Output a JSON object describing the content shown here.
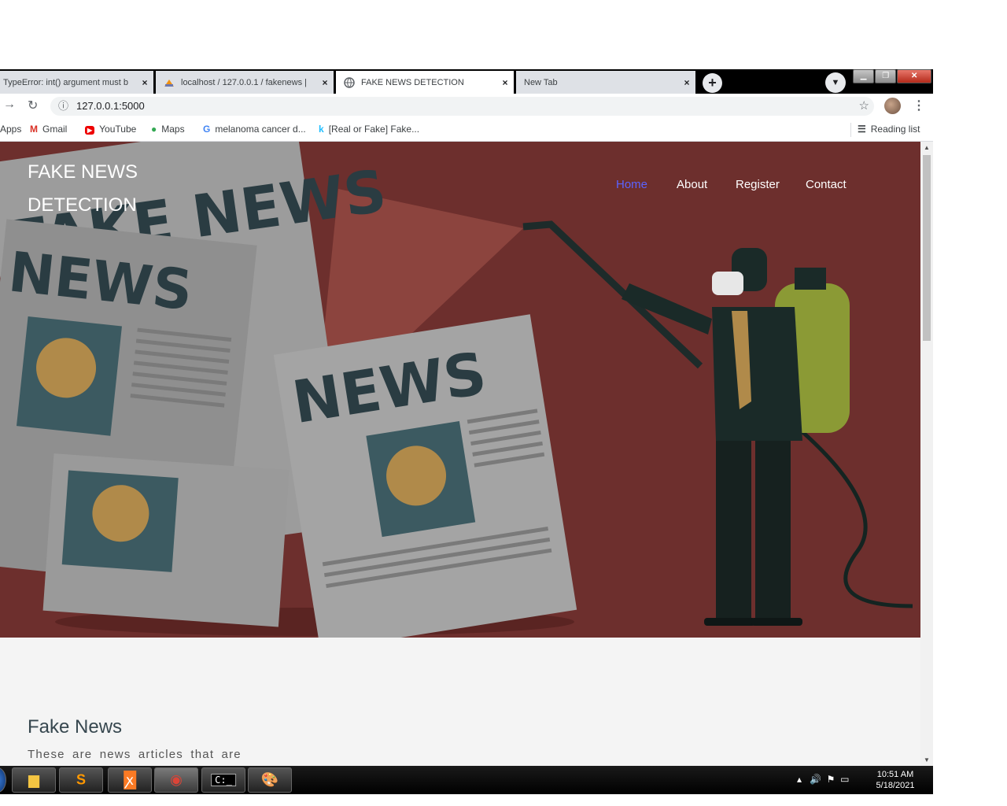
{
  "browser": {
    "tabs": [
      {
        "title": "TypeError: int() argument must b",
        "active": false
      },
      {
        "title": "localhost / 127.0.0.1 / fakenews |",
        "active": false
      },
      {
        "title": "FAKE NEWS DETECTION",
        "active": true
      },
      {
        "title": "New Tab",
        "active": false
      }
    ],
    "close_glyph": "×",
    "new_tab_glyph": "+",
    "url": "127.0.0.1:5000",
    "bookmarks": [
      {
        "label": "Apps",
        "icon": "apps-grid-icon"
      },
      {
        "label": "Gmail",
        "icon": "gmail-icon"
      },
      {
        "label": "YouTube",
        "icon": "youtube-icon"
      },
      {
        "label": "Maps",
        "icon": "maps-pin-icon"
      },
      {
        "label": "melanoma cancer d...",
        "icon": "google-g-icon"
      },
      {
        "label": "[Real or Fake] Fake...",
        "icon": "kaggle-k-icon"
      }
    ],
    "reading_list": "Reading list"
  },
  "page": {
    "brand_line1": "FAKE NEWS",
    "brand_line2": "DETECTION",
    "nav": [
      {
        "label": "Home",
        "active": true
      },
      {
        "label": "About",
        "active": false
      },
      {
        "label": "Register",
        "active": false
      },
      {
        "label": "Contact",
        "active": false
      }
    ],
    "hero_image_text": [
      "FAKE NEWS",
      "NEWS",
      "NEWS"
    ],
    "section_title": "Fake News",
    "section_text": "These are news articles that are"
  },
  "taskbar": {
    "time": "10:51 AM",
    "date": "5/18/2021"
  },
  "colors": {
    "hero_bg": "#6d2f2d",
    "nav_active": "#5b63ff"
  }
}
